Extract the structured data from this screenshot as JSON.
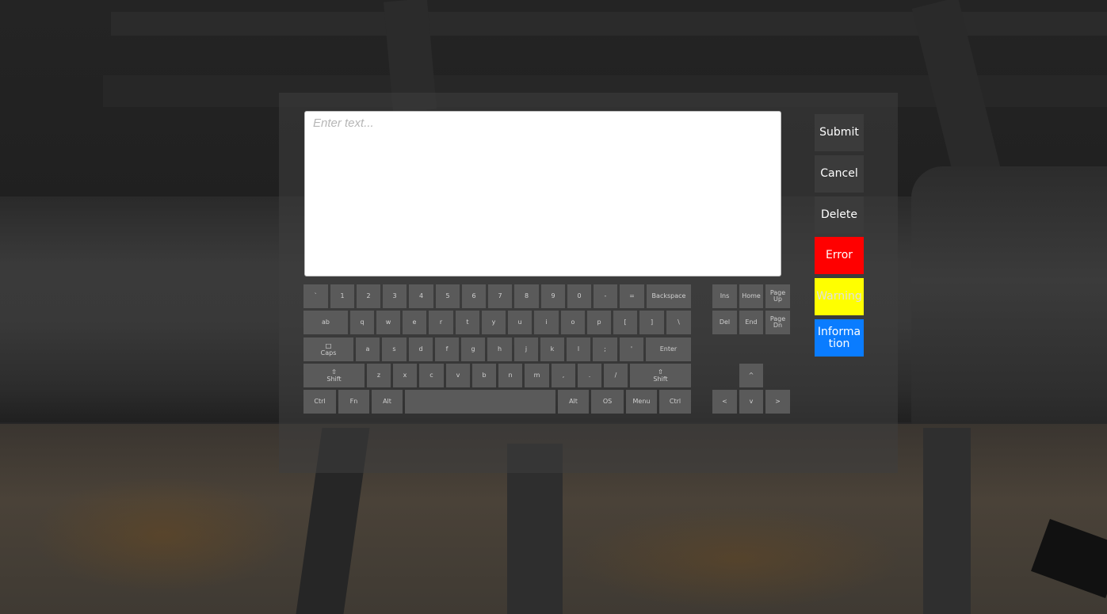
{
  "textbox": {
    "placeholder": "Enter text...",
    "value": ""
  },
  "keyboard": {
    "row1": [
      "`",
      "1",
      "2",
      "3",
      "4",
      "5",
      "6",
      "7",
      "8",
      "9",
      "0",
      "-",
      "=",
      "Backspace"
    ],
    "row2": [
      "ab",
      "q",
      "w",
      "e",
      "r",
      "t",
      "y",
      "u",
      "i",
      "o",
      "p",
      "[",
      "]",
      "\\"
    ],
    "row3": [
      "Caps",
      "a",
      "s",
      "d",
      "f",
      "g",
      "h",
      "j",
      "k",
      "l",
      ";",
      "'",
      "Enter"
    ],
    "row4": [
      "Shift",
      "z",
      "x",
      "c",
      "v",
      "b",
      "n",
      "m",
      ",",
      ".",
      "/",
      "Shift"
    ],
    "row5": [
      "Ctrl",
      "Fn",
      "Alt",
      "",
      "Alt",
      "OS",
      "Menu",
      "Ctrl"
    ],
    "nav_row1": [
      "Ins",
      "Home",
      "Page Up"
    ],
    "nav_row2": [
      "Del",
      "End",
      "Page Dn"
    ],
    "arrows": {
      "up": "^",
      "left": "<",
      "down": "v",
      "right": ">"
    }
  },
  "side_buttons": {
    "submit": "Submit",
    "cancel": "Cancel",
    "delete": "Delete",
    "error": "Error",
    "warning": "Warning",
    "information": "Information"
  },
  "colors": {
    "key_bg": "#5a5a5a",
    "button_bg": "#3b3b3b",
    "error": "#ff0000",
    "warning": "#ffff00",
    "information": "#0a7cff"
  },
  "icons": {
    "caps": "caps-lock-icon",
    "shift": "shift-icon"
  }
}
